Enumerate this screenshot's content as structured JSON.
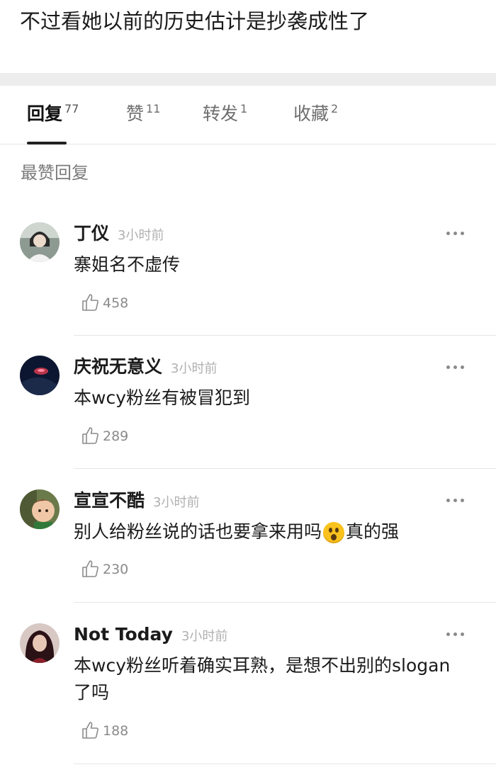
{
  "post": {
    "text": "不过看她以前的历史估计是抄袭成性了"
  },
  "tabs": [
    {
      "label": "回复",
      "count": "77"
    },
    {
      "label": "赞",
      "count": "11"
    },
    {
      "label": "转发",
      "count": "1"
    },
    {
      "label": "收藏",
      "count": "2"
    }
  ],
  "section_heading": "最赞回复",
  "comments": [
    {
      "user": "丁仪",
      "time": "3小时前",
      "text": "寨姐名不虚传",
      "likes": "458",
      "avatar_color": "#5b6a63"
    },
    {
      "user": "庆祝无意义",
      "time": "3小时前",
      "text": "本wcy粉丝有被冒犯到",
      "likes": "289",
      "avatar_color": "#0d1a3a"
    },
    {
      "user": "宣宣不酷",
      "time": "3小时前",
      "text_before": "别人给粉丝说的话也要拿来用吗",
      "emoji": "hushed-face-emoji",
      "text_after": "真的强",
      "likes": "230",
      "avatar_color": "#b79a6f"
    },
    {
      "user": "Not Today",
      "time": "3小时前",
      "text": "本wcy粉丝听着确实耳熟，是想不出别的slogan了吗",
      "likes": "188",
      "avatar_color": "#3a1f22"
    }
  ],
  "icons": {
    "more": "more-dots-icon",
    "like": "thumbs-up-icon"
  }
}
